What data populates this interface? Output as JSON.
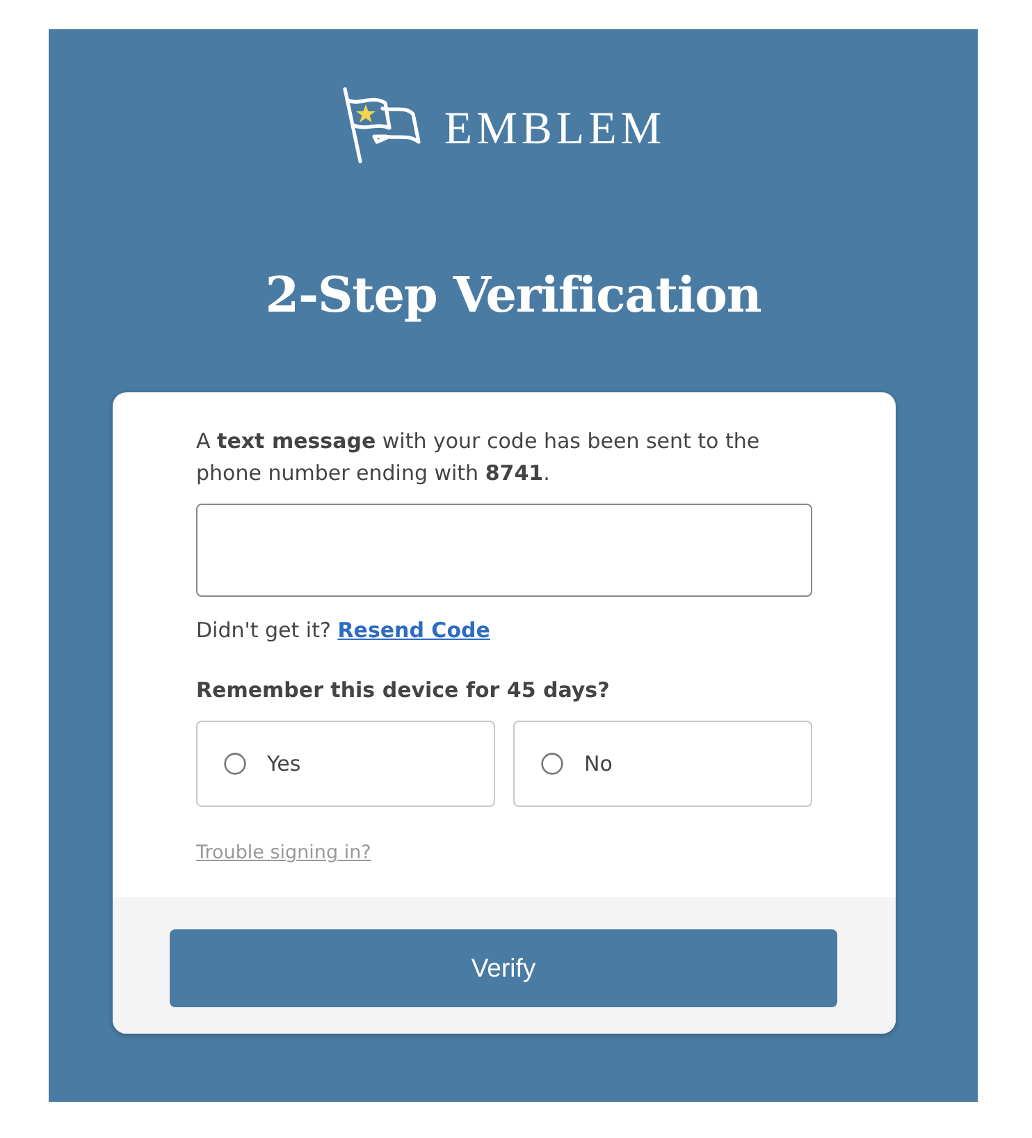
{
  "brand": {
    "name": "EMBLEM"
  },
  "title": "2-Step Verification",
  "form": {
    "message": "A **text message** with your code has been sent to the phone number ending with **8741**.",
    "resend": {
      "prompt": "Didn't get it?",
      "link": "Resend Code"
    },
    "remember": {
      "question": "Remember this device for 45 days?",
      "options": [
        {
          "label": "Yes",
          "selected": false
        },
        {
          "label": "No",
          "selected": false
        }
      ]
    },
    "help_link": "Trouble signing in?",
    "submit_button": "Verify"
  }
}
